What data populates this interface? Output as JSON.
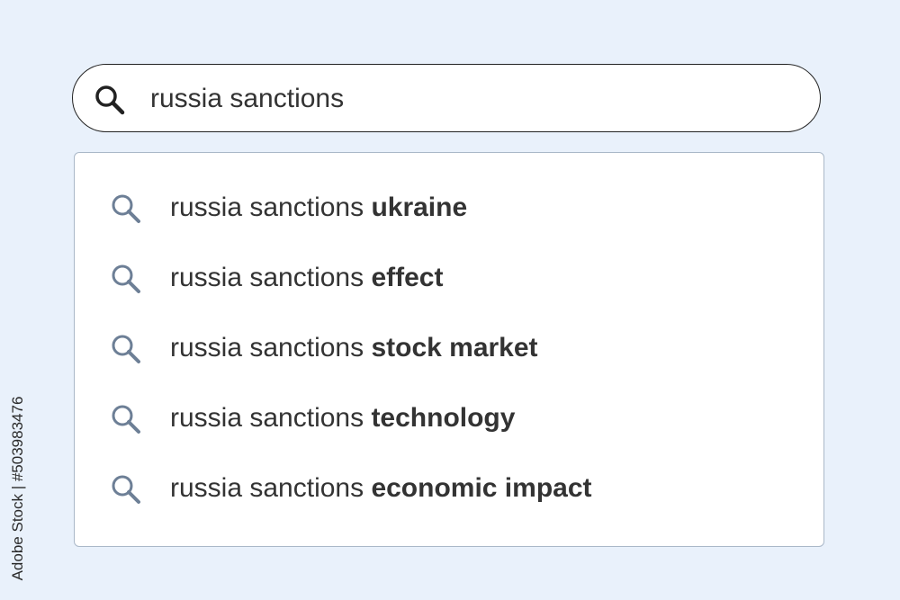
{
  "search": {
    "query": "russia sanctions"
  },
  "suggestions": [
    {
      "prefix": "russia sanctions ",
      "completion": "ukraine"
    },
    {
      "prefix": "russia sanctions ",
      "completion": "effect"
    },
    {
      "prefix": "russia sanctions ",
      "completion": "stock market"
    },
    {
      "prefix": "russia sanctions ",
      "completion": "technology"
    },
    {
      "prefix": "russia sanctions ",
      "completion": "economic impact"
    }
  ],
  "watermark": {
    "credit": "Adobe Stock | #503983476"
  },
  "colors": {
    "background": "#e9f1fb",
    "search_icon_main": "#222222",
    "search_icon_suggestion": "#6d7f96"
  },
  "icons": {
    "search": "search-icon",
    "suggestion": "search-icon"
  }
}
